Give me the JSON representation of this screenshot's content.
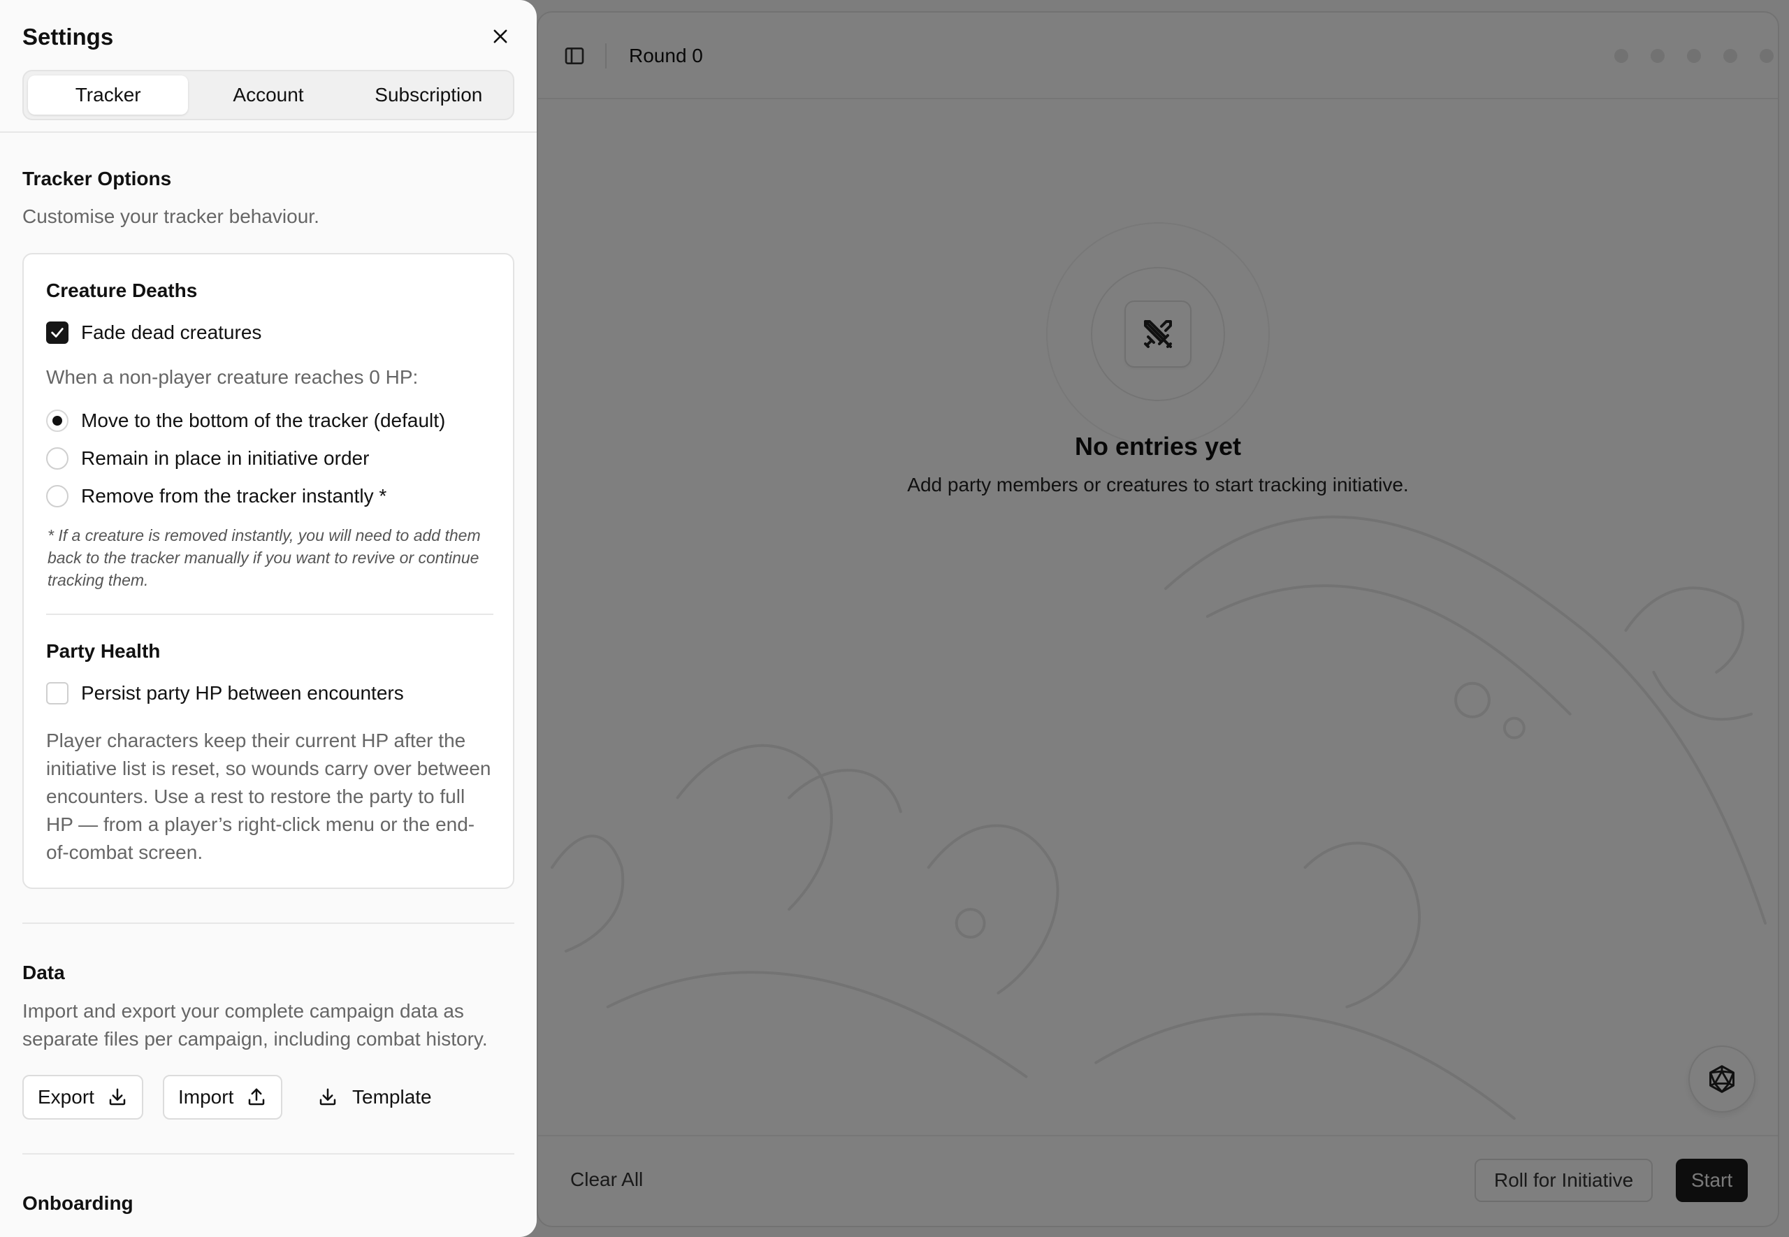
{
  "header": {
    "round_label": "Round 0"
  },
  "empty_state": {
    "title": "No entries yet",
    "subtitle": "Add party members or creatures to start tracking initiative."
  },
  "footer": {
    "clear_all_label": "Clear All",
    "roll_label": "Roll for Initiative",
    "start_label": "Start"
  },
  "settings": {
    "title": "Settings",
    "tabs": [
      {
        "label": "Tracker",
        "active": true
      },
      {
        "label": "Account",
        "active": false
      },
      {
        "label": "Subscription",
        "active": false
      }
    ],
    "tracker_options": {
      "title": "Tracker Options",
      "description": "Customise your tracker behaviour.",
      "creature_deaths": {
        "heading": "Creature Deaths",
        "fade_label": "Fade dead creatures",
        "fade_checked": true,
        "prompt": "When a non-player creature reaches 0 HP:",
        "options": [
          {
            "label": "Move to the bottom of the tracker (default)",
            "selected": true
          },
          {
            "label": "Remain in place in initiative order",
            "selected": false
          },
          {
            "label": "Remove from the tracker instantly *",
            "selected": false
          }
        ],
        "footnote": "* If a creature is removed instantly, you will need to add them back to the tracker manually if you want to revive or continue tracking them."
      },
      "party_health": {
        "heading": "Party Health",
        "persist_label": "Persist party HP between encounters",
        "persist_checked": false,
        "description": "Player characters keep their current HP after the initiative list is reset, so wounds carry over between encounters. Use a rest to restore the party to full HP — from a player’s right-click menu or the end-of-combat screen."
      }
    },
    "data": {
      "title": "Data",
      "description": "Import and export your complete campaign data as separate files per campaign, including combat history.",
      "export_label": "Export",
      "import_label": "Import",
      "template_label": "Template"
    },
    "onboarding": {
      "title": "Onboarding"
    }
  },
  "colors": {
    "accent": "#161616",
    "overlay": "rgba(0,0,0,0.5)",
    "muted_text": "#666666"
  }
}
